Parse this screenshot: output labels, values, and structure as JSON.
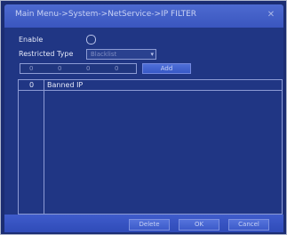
{
  "window": {
    "title": "Main Menu->System->NetService->IP FILTER",
    "close_symbol": "✕"
  },
  "form": {
    "enable_label": "Enable",
    "enable_checked": false,
    "restricted_type_label": "Restricted Type",
    "restricted_type_value": "Blacklist",
    "ip_segments": [
      "0",
      "0",
      "0",
      "0"
    ],
    "add_label": "Add"
  },
  "list": {
    "col_number": "0",
    "col_ip": "Banned IP",
    "rows": []
  },
  "footer": {
    "delete_label": "Delete",
    "ok_label": "OK",
    "cancel_label": "Cancel"
  }
}
